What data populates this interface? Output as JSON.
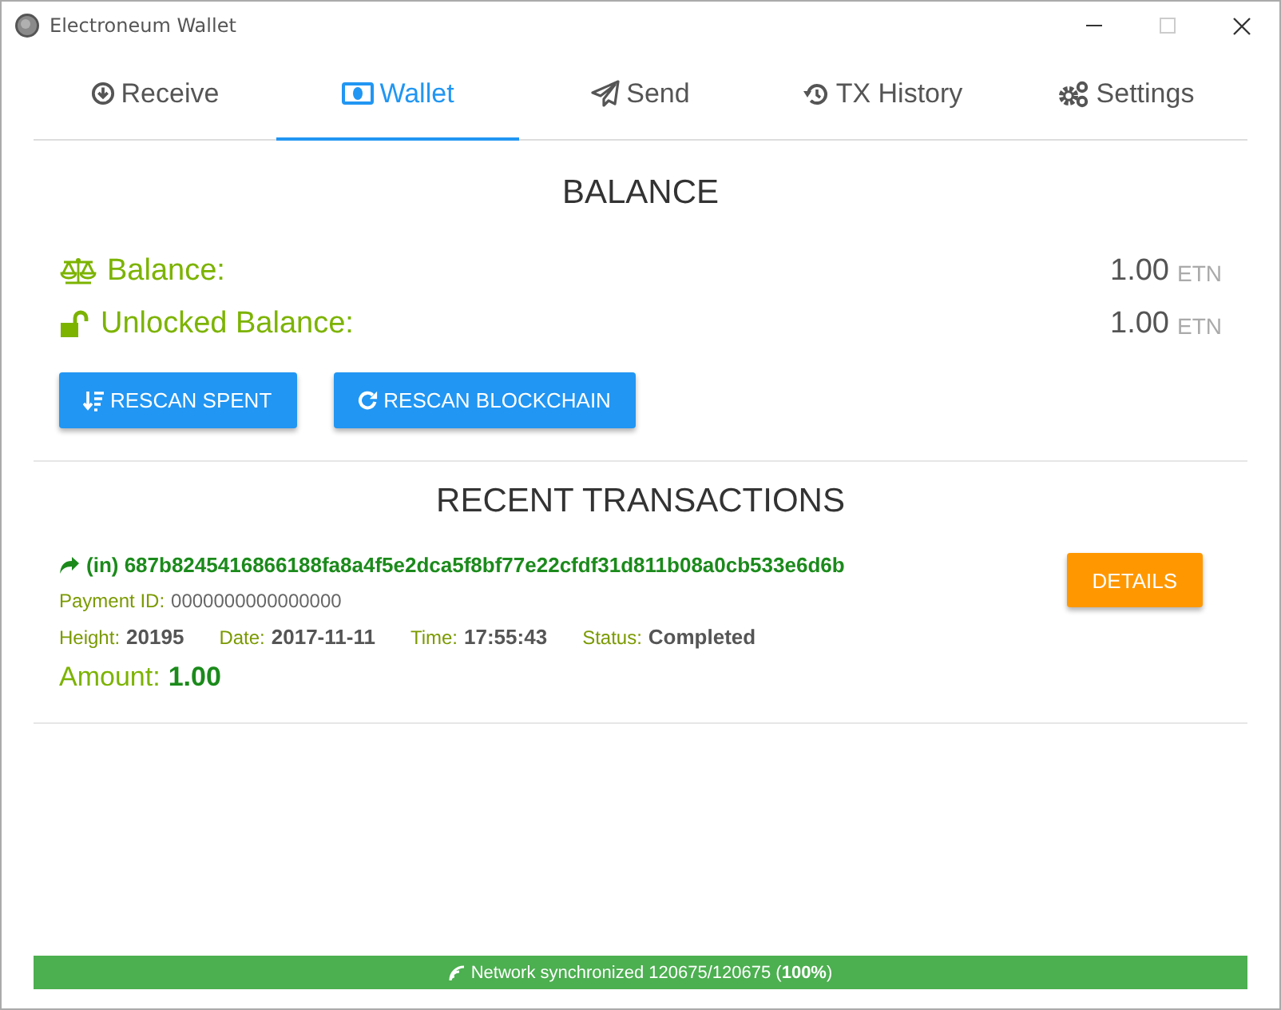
{
  "window": {
    "title": "Electroneum Wallet"
  },
  "tabs": [
    {
      "label": "Receive",
      "selected": false
    },
    {
      "label": "Wallet",
      "selected": true
    },
    {
      "label": "Send",
      "selected": false
    },
    {
      "label": "TX History",
      "selected": false
    },
    {
      "label": "Settings",
      "selected": false
    }
  ],
  "balance": {
    "heading": "BALANCE",
    "rows": [
      {
        "label": "Balance:",
        "amount": "1.00",
        "unit": "ETN"
      },
      {
        "label": "Unlocked Balance:",
        "amount": "1.00",
        "unit": "ETN"
      }
    ],
    "buttons": [
      "RESCAN SPENT",
      "RESCAN BLOCKCHAIN"
    ]
  },
  "transactions": {
    "heading": "RECENT TRANSACTIONS",
    "items": [
      {
        "direction": "(in)",
        "hash": "687b8245416866188fa8a4f5e2dca5f8bf77e22cfdf31d811b08a0cb533e6d6b",
        "payment_id_label": "Payment ID:",
        "payment_id": "0000000000000000",
        "fields": [
          {
            "label": "Height:",
            "value": "20195"
          },
          {
            "label": "Date:",
            "value": "2017-11-11"
          },
          {
            "label": "Time:",
            "value": "17:55:43"
          },
          {
            "label": "Status:",
            "value": "Completed"
          }
        ],
        "amount_label": "Amount:",
        "amount": "1.00",
        "button": "DETAILS"
      }
    ]
  },
  "status_bar": {
    "text": "Network synchronized 120675/120675 (**100%**)"
  }
}
